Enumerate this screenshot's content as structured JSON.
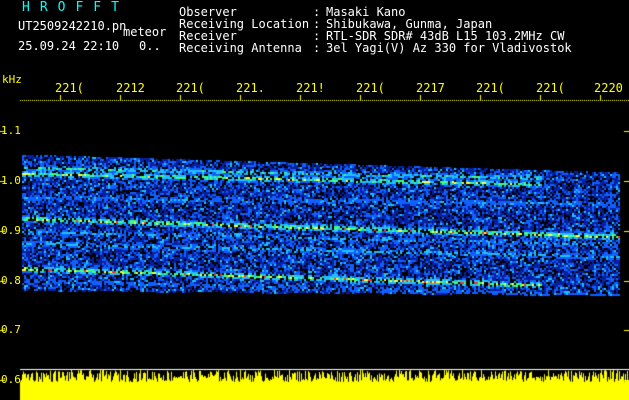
{
  "header": {
    "logo": "HROFFT",
    "filename": "UT2509242210.pn",
    "meteor_label": "meteor",
    "datetime": "25.09.24 22:10",
    "dot_zero": "0..",
    "info": [
      {
        "label": "Observer",
        "value": "Masaki Kano"
      },
      {
        "label": "Receiving Location",
        "value": "Shibukawa, Gunma, Japan"
      },
      {
        "label": "Receiver",
        "value": "RTL-SDR SDR# 43dB L15 103.2MHz CW"
      },
      {
        "label": "Receiving Antenna",
        "value": "3el Yagi(V) Az 330 for Vladivostok"
      }
    ],
    "colon": ":"
  },
  "axes": {
    "y_unit": "kHz",
    "x_ticks": [
      "221(",
      "2212",
      "221(",
      "221.",
      "221!",
      "221(",
      "2217",
      "221(",
      "221(",
      "2220"
    ],
    "y_ticks": [
      "1.1",
      "1.0",
      "0.9",
      "0.8",
      "0.7",
      "0.6"
    ]
  },
  "colors": {
    "background": "#000000",
    "axis_text": "#ffff00",
    "header_text": "#ffffff",
    "logo_text": "#00ffff",
    "noise_bar": "#ffff00"
  }
}
